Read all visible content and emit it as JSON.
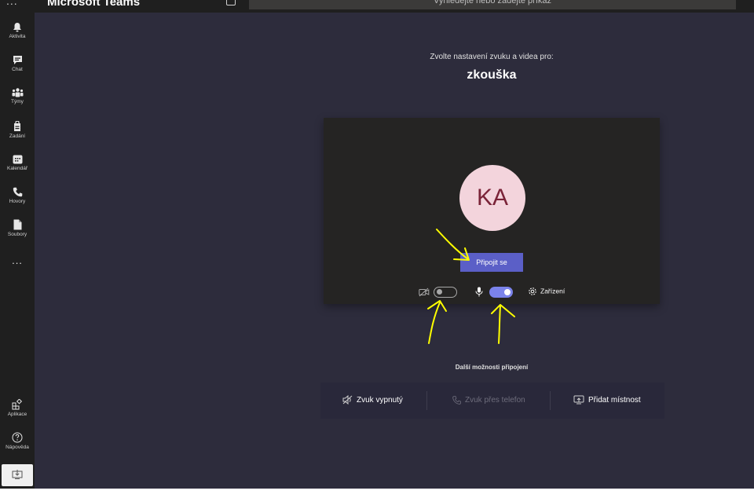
{
  "titlebar": {
    "dots": "...",
    "app_name": "Microsoft Teams",
    "search_text": "Vyhledejte nebo zadejte příkaz"
  },
  "rail": {
    "items": [
      {
        "label": "Aktivita",
        "icon": "bell-icon"
      },
      {
        "label": "Chat",
        "icon": "chat-icon"
      },
      {
        "label": "Týmy",
        "icon": "teams-icon"
      },
      {
        "label": "Zadání",
        "icon": "assignments-icon"
      },
      {
        "label": "Kalendář",
        "icon": "calendar-icon"
      },
      {
        "label": "Hovory",
        "icon": "phone-icon"
      },
      {
        "label": "Soubory",
        "icon": "files-icon"
      }
    ],
    "more": "...",
    "apps_label": "Aplikace",
    "help_label": "Nápověda"
  },
  "prejoin": {
    "subtitle": "Zvolte nastavení zvuku a videa pro:",
    "meeting_name": "zkouška",
    "avatar_initials": "KA",
    "join_label": "Připojit se",
    "camera_on": false,
    "microphone_on": true,
    "devices_label": "Zařízení"
  },
  "other_options": {
    "title": "Další možnosti připojení",
    "audio_off": "Zvuk vypnutý",
    "phone_audio": "Zvuk přes telefon",
    "add_room": "Přidat místnost"
  },
  "colors": {
    "rail_bg": "#1f1f1f",
    "main_bg": "#2d2c3c",
    "accent": "#5b5fc7",
    "toggle_on": "#7b83eb",
    "avatar_bg": "#f3d4dc",
    "avatar_fg": "#7a2338",
    "annotation": "#ffff00"
  }
}
